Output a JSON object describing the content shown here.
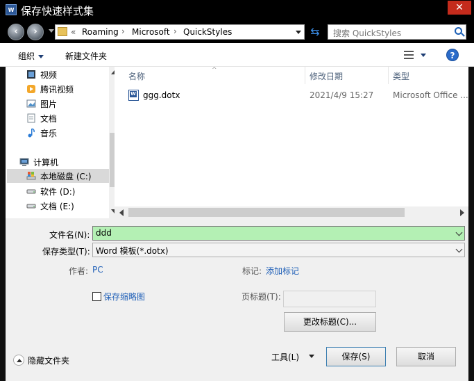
{
  "window": {
    "title": "保存快速样式集",
    "icon": "word-icon",
    "close_label": "✕"
  },
  "nav": {
    "back_icon": "back-icon",
    "forward_icon": "forward-icon",
    "breadcrumbs": [
      "«",
      "Roaming",
      "Microsoft",
      "QuickStyles"
    ],
    "separator": "›",
    "search_placeholder": "搜索 QuickStyles"
  },
  "toolbar": {
    "organize_label": "组织",
    "new_folder_label": "新建文件夹",
    "help_label": "?"
  },
  "sidebar": {
    "items": [
      {
        "label": "视频",
        "icon": "video-icon"
      },
      {
        "label": "腾讯视频",
        "icon": "tencent-video-icon"
      },
      {
        "label": "图片",
        "icon": "picture-icon"
      },
      {
        "label": "文档",
        "icon": "document-icon"
      },
      {
        "label": "音乐",
        "icon": "music-icon"
      },
      {
        "label": "计算机",
        "icon": "computer-icon"
      },
      {
        "label": "本地磁盘 (C:)",
        "icon": "drive-c-icon"
      },
      {
        "label": "软件 (D:)",
        "icon": "drive-icon"
      },
      {
        "label": "文档 (E:)",
        "icon": "drive-icon"
      }
    ]
  },
  "files": {
    "columns": [
      "名称",
      "修改日期",
      "类型"
    ],
    "rows": [
      {
        "name": "ggg.dotx",
        "modified": "2021/4/9 15:27",
        "type": "Microsoft Office ..."
      }
    ]
  },
  "form": {
    "filename_label": "文件名(N):",
    "filename_value": "ddd",
    "filetype_label": "保存类型(T):",
    "filetype_value": "Word 模板(*.dotx)",
    "author_label": "作者:",
    "author_value": "PC",
    "tags_label": "标记:",
    "tags_value": "添加标记",
    "thumbnail_label": "保存缩略图",
    "page_title_label": "页标题(T):",
    "change_title_label": "更改标题(C)...",
    "tools_label": "工具(L)",
    "save_label": "保存(S)",
    "cancel_label": "取消",
    "hide_folders_label": "隐藏文件夹"
  },
  "colors": {
    "filename_highlight": "#b4f0b4",
    "close_button": "#c42b1c",
    "link": "#1f5fb7"
  }
}
